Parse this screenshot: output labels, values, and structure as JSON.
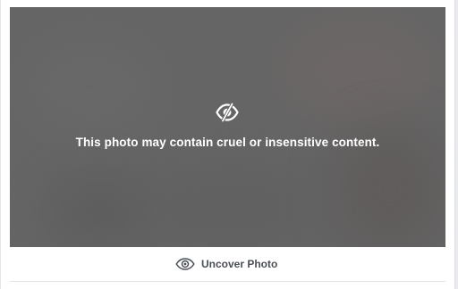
{
  "warning": {
    "message": "This photo may contain cruel or insensitive content.",
    "icon": "eye-slash-icon"
  },
  "footer": {
    "uncover_label": "Uncover Photo",
    "uncover_icon": "eye-icon"
  },
  "colors": {
    "overlay": "#656565",
    "warning_text": "#ffffff",
    "button_text": "#4b4f56",
    "page_background": "#e9ebee"
  }
}
